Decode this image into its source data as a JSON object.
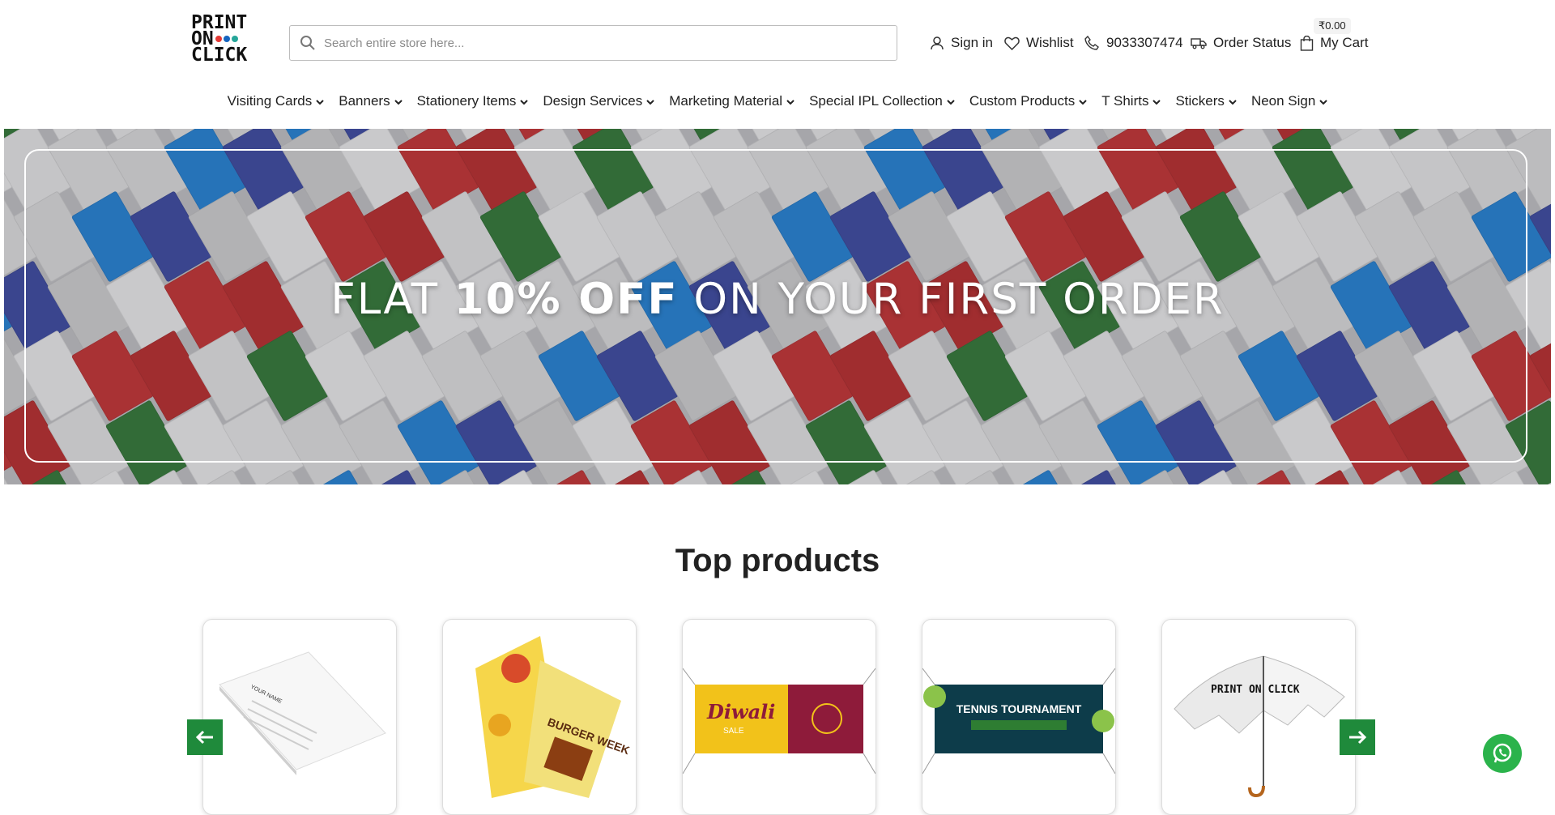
{
  "brand": {
    "logo_lines": [
      "PRINT",
      "ON",
      "CLICK"
    ],
    "dot_colors": [
      "#e53935",
      "#1565c0",
      "#26a69a"
    ]
  },
  "search": {
    "placeholder": "Search entire store here..."
  },
  "header_links": {
    "sign_in": "Sign in",
    "wishlist": "Wishlist",
    "phone": "9033307474",
    "order_status": "Order Status",
    "cart": "My Cart",
    "cart_total": "₹0.00"
  },
  "nav": [
    "Visiting Cards",
    "Banners",
    "Stationery Items",
    "Design Services",
    "Marketing Material",
    "Special IPL Collection",
    "Custom Products",
    "T Shirts",
    "Stickers",
    "Neon Sign"
  ],
  "hero": {
    "pre": "FLAT ",
    "bold": "10% OFF",
    "post": " ON YOUR FIRST ORDER"
  },
  "section": {
    "title": "Top products"
  },
  "products": [
    {
      "name": "letterhead",
      "label": "YOUR NAME"
    },
    {
      "name": "brochure",
      "label": "BURGER WEEK"
    },
    {
      "name": "diwali-banner",
      "label": "Diwali",
      "sub": "SALE"
    },
    {
      "name": "tennis-banner",
      "label": "TENNIS TOURNAMENT"
    },
    {
      "name": "umbrella",
      "label": "PRINT ON CLICK"
    }
  ],
  "colors": {
    "accent_green": "#1f8a3b",
    "whatsapp": "#2bb34b"
  }
}
